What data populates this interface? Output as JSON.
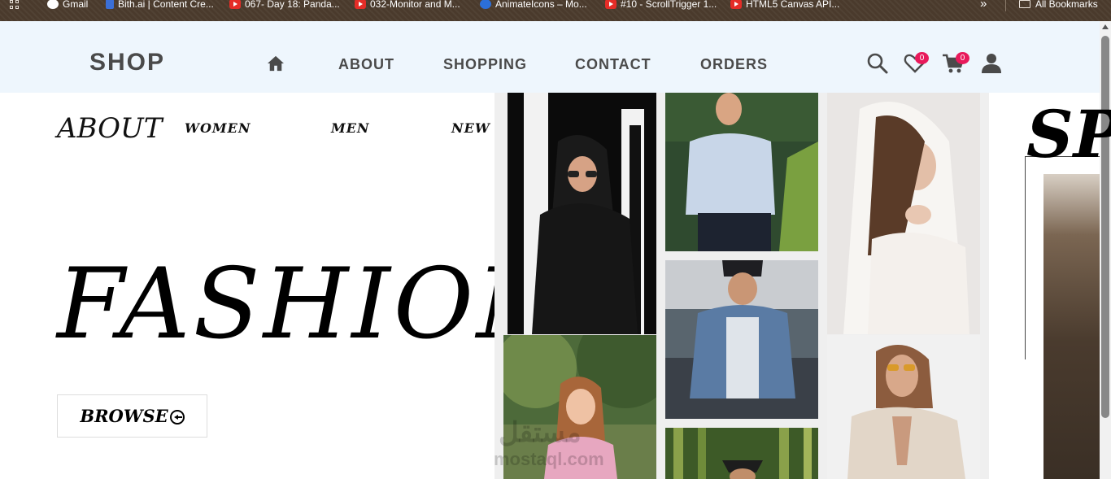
{
  "bookmarks": {
    "items": [
      {
        "label": "Gmail",
        "icon": "google-icon"
      },
      {
        "label": "Bith.ai | Content Cre...",
        "icon": "bookmark-icon"
      },
      {
        "label": "067- Day 18: Panda...",
        "icon": "youtube-icon"
      },
      {
        "label": "032-Monitor and M...",
        "icon": "youtube-icon"
      },
      {
        "label": "AnimateIcons – Mo...",
        "icon": "animate-icon"
      },
      {
        "label": "#10 - ScrollTrigger 1...",
        "icon": "youtube-icon"
      },
      {
        "label": "HTML5 Canvas API...",
        "icon": "youtube-icon"
      }
    ],
    "more": "»",
    "all_bookmarks": "All Bookmarks"
  },
  "nav": {
    "logo": "SHOP",
    "links": [
      "ABOUT",
      "SHOPPING",
      "CONTACT",
      "ORDERS"
    ],
    "wishlist_count": "0",
    "cart_count": "0"
  },
  "hero": {
    "about_title": "ABOUT",
    "categories": [
      "WOMEN",
      "MEN",
      "NEW COLLECTION"
    ],
    "headline": "FASHION",
    "browse_label": "BROWSE"
  },
  "watermark": {
    "arabic": "مستقل",
    "latin": "mostaql.com"
  },
  "side_section": {
    "title": "SP"
  },
  "colors": {
    "nav_bg": "#eef6fd",
    "badge": "#e8195b",
    "text": "#4a4a4a"
  }
}
